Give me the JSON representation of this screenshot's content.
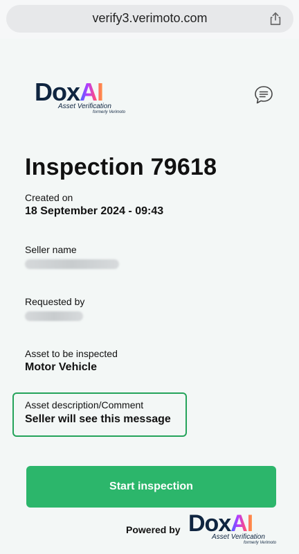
{
  "browser": {
    "url": "verify3.verimoto.com",
    "share_icon": "share-icon"
  },
  "brand": {
    "logo_text_main": "Dox",
    "logo_text_accent": "AI",
    "tagline": "Asset Verification",
    "subtagline": "formerly Verimoto",
    "logo_text_color": "#0f2540"
  },
  "header": {
    "chat_icon": "chat-icon"
  },
  "inspection": {
    "title": "Inspection  79618",
    "created_label": "Created on",
    "created_value": "18 September 2024 - 09:43",
    "seller_label": "Seller name",
    "requested_label": "Requested by",
    "asset_label": "Asset to be inspected",
    "asset_value": "Motor Vehicle",
    "comment_label": "Asset description/Comment",
    "comment_value": "Seller will see this message"
  },
  "actions": {
    "start_label": "Start inspection",
    "accent": "#2cb66b"
  },
  "footer": {
    "powered_label": "Powered by"
  }
}
